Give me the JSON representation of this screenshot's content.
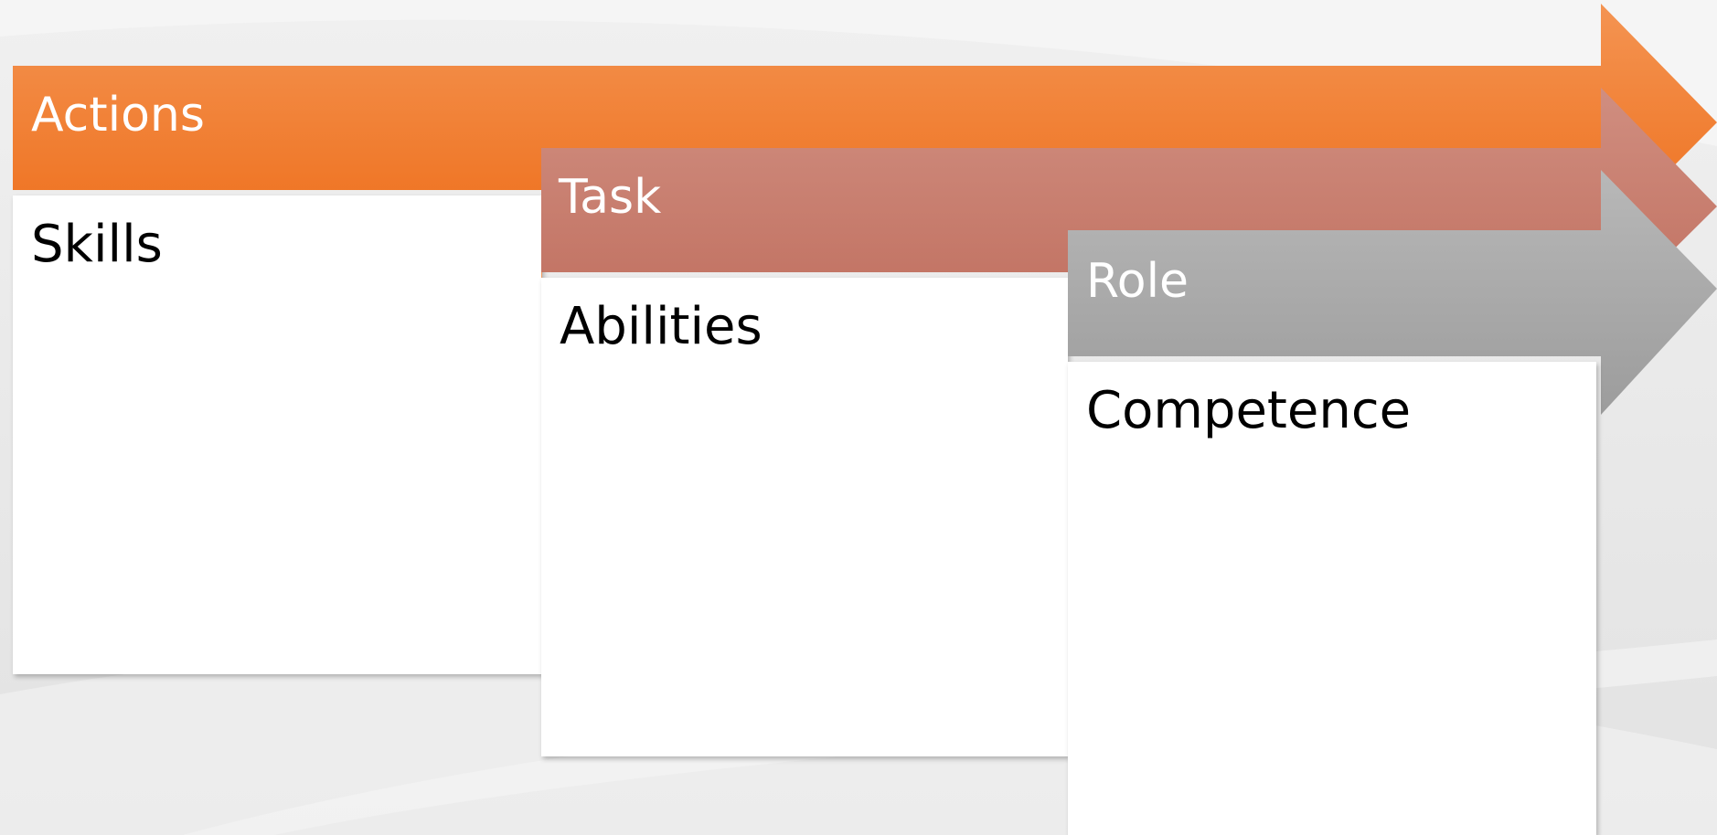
{
  "stages": [
    {
      "header": "Actions",
      "body": "Skills",
      "color": "#f07a26",
      "icon": "right-arrow-icon"
    },
    {
      "header": "Task",
      "body": "Abilities",
      "color": "#c87a6b",
      "icon": "right-arrow-icon"
    },
    {
      "header": "Role",
      "body": "Competence",
      "color": "#a8a8a8",
      "icon": "right-arrow-icon"
    }
  ]
}
